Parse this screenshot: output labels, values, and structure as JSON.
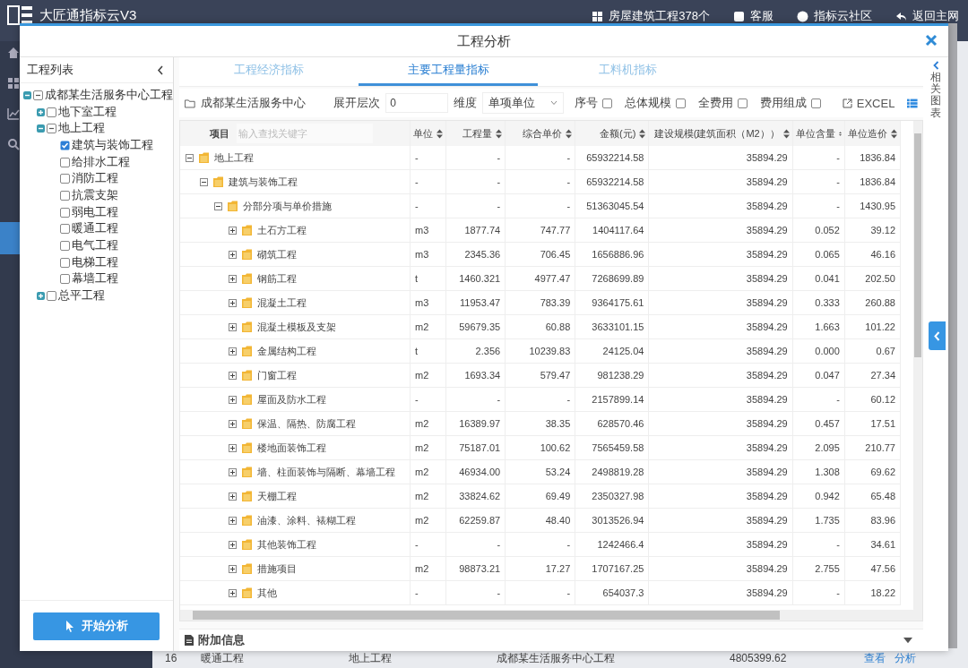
{
  "background": {
    "app_title": "大匠通指标云V3",
    "header_links": [
      {
        "label": "房屋建筑工程378个"
      },
      {
        "label": "客服"
      },
      {
        "label": "指标云社区"
      },
      {
        "label": "返回主网"
      }
    ],
    "row": {
      "number": "16",
      "name": "暖通工程",
      "parent": "地上工程",
      "project": "成都某生活服务中心工程",
      "amount": "4805399.62",
      "actions": [
        "查看",
        "分析"
      ]
    }
  },
  "dialog": {
    "title": "工程分析"
  },
  "project_tree": {
    "title": "工程列表",
    "items": [
      {
        "label": "成都某生活服务中心工程",
        "expanded": true,
        "checked": false,
        "partial": true,
        "children": [
          {
            "label": "地下室工程",
            "expanded": false,
            "checked": false,
            "partial": false
          },
          {
            "label": "地上工程",
            "expanded": true,
            "checked": false,
            "partial": true,
            "children": [
              {
                "label": "建筑与装饰工程",
                "checked": true,
                "partial": false
              },
              {
                "label": "给排水工程",
                "checked": false,
                "partial": false
              },
              {
                "label": "消防工程",
                "checked": false,
                "partial": false
              },
              {
                "label": "抗震支架",
                "checked": false,
                "partial": false
              },
              {
                "label": "弱电工程",
                "checked": false,
                "partial": false
              },
              {
                "label": "暖通工程",
                "checked": false,
                "partial": false
              },
              {
                "label": "电气工程",
                "checked": false,
                "partial": false
              },
              {
                "label": "电梯工程",
                "checked": false,
                "partial": false
              },
              {
                "label": "幕墙工程",
                "checked": false,
                "partial": false
              }
            ]
          },
          {
            "label": "总平工程",
            "expanded": false,
            "checked": false,
            "partial": false
          }
        ]
      }
    ]
  },
  "start_button": "开始分析",
  "tabs": [
    {
      "label": "工程经济指标",
      "selected": false
    },
    {
      "label": "主要工程量指标",
      "selected": true
    },
    {
      "label": "工料机指标",
      "selected": false
    }
  ],
  "toolbar": {
    "project": "成都某生活服务中心",
    "level_label": "展开层次",
    "level_value": "0",
    "dimension_label": "维度",
    "dimension_value": "单项单位",
    "options": [
      {
        "label": "序号",
        "checked": false
      },
      {
        "label": "总体规模",
        "checked": false
      },
      {
        "label": "全费用",
        "checked": false
      },
      {
        "label": "费用组成",
        "checked": false
      }
    ],
    "export": "EXCEL"
  },
  "table": {
    "search_placeholder": "输入查找关键字",
    "columns": [
      {
        "label": "项目",
        "sortable": false
      },
      {
        "label": "单位",
        "sortable": true
      },
      {
        "label": "工程量",
        "sortable": true
      },
      {
        "label": "综合单价",
        "sortable": true
      },
      {
        "label": "金额(元)",
        "sortable": true
      },
      {
        "label": "建设规模(建筑面积（M2））",
        "sortable": true
      },
      {
        "label": "单位含量",
        "sortable": true
      },
      {
        "label": "单位造价",
        "sortable": true
      }
    ],
    "rows": [
      {
        "name": "地上工程",
        "unit": "-",
        "quantity": "-",
        "unit_price": "-",
        "amount": "65932214.58",
        "scale": "35894.29",
        "content": "-",
        "cost": "1836.84",
        "expanded": true,
        "children": [
          {
            "name": "建筑与装饰工程",
            "unit": "-",
            "quantity": "-",
            "unit_price": "-",
            "amount": "65932214.58",
            "scale": "35894.29",
            "content": "-",
            "cost": "1836.84",
            "expanded": true,
            "children": [
              {
                "name": "分部分项与单价措施",
                "unit": "-",
                "quantity": "-",
                "unit_price": "-",
                "amount": "51363045.54",
                "scale": "35894.29",
                "content": "-",
                "cost": "1430.95",
                "expanded": true,
                "children": [
                  {
                    "name": "土石方工程",
                    "unit": "m3",
                    "quantity": "1877.74",
                    "unit_price": "747.77",
                    "amount": "1404117.64",
                    "scale": "35894.29",
                    "content": "0.052",
                    "cost": "39.12",
                    "expanded": false
                  },
                  {
                    "name": "砌筑工程",
                    "unit": "m3",
                    "quantity": "2345.36",
                    "unit_price": "706.45",
                    "amount": "1656886.96",
                    "scale": "35894.29",
                    "content": "0.065",
                    "cost": "46.16",
                    "expanded": false
                  },
                  {
                    "name": "钢筋工程",
                    "unit": "t",
                    "quantity": "1460.321",
                    "unit_price": "4977.47",
                    "amount": "7268699.89",
                    "scale": "35894.29",
                    "content": "0.041",
                    "cost": "202.50",
                    "expanded": false
                  },
                  {
                    "name": "混凝土工程",
                    "unit": "m3",
                    "quantity": "11953.47",
                    "unit_price": "783.39",
                    "amount": "9364175.61",
                    "scale": "35894.29",
                    "content": "0.333",
                    "cost": "260.88",
                    "expanded": false
                  },
                  {
                    "name": "混凝土模板及支架",
                    "unit": "m2",
                    "quantity": "59679.35",
                    "unit_price": "60.88",
                    "amount": "3633101.15",
                    "scale": "35894.29",
                    "content": "1.663",
                    "cost": "101.22",
                    "expanded": false
                  },
                  {
                    "name": "金属结构工程",
                    "unit": "t",
                    "quantity": "2.356",
                    "unit_price": "10239.83",
                    "amount": "24125.04",
                    "scale": "35894.29",
                    "content": "0.000",
                    "cost": "0.67",
                    "expanded": false
                  },
                  {
                    "name": "门窗工程",
                    "unit": "m2",
                    "quantity": "1693.34",
                    "unit_price": "579.47",
                    "amount": "981238.29",
                    "scale": "35894.29",
                    "content": "0.047",
                    "cost": "27.34",
                    "expanded": false
                  },
                  {
                    "name": "屋面及防水工程",
                    "unit": "-",
                    "quantity": "-",
                    "unit_price": "-",
                    "amount": "2157899.14",
                    "scale": "35894.29",
                    "content": "-",
                    "cost": "60.12",
                    "expanded": false
                  },
                  {
                    "name": "保温、隔热、防腐工程",
                    "unit": "m2",
                    "quantity": "16389.97",
                    "unit_price": "38.35",
                    "amount": "628570.46",
                    "scale": "35894.29",
                    "content": "0.457",
                    "cost": "17.51",
                    "expanded": false
                  },
                  {
                    "name": "楼地面装饰工程",
                    "unit": "m2",
                    "quantity": "75187.01",
                    "unit_price": "100.62",
                    "amount": "7565459.58",
                    "scale": "35894.29",
                    "content": "2.095",
                    "cost": "210.77",
                    "expanded": false
                  },
                  {
                    "name": "墙、柱面装饰与隔断、幕墙工程",
                    "unit": "m2",
                    "quantity": "46934.00",
                    "unit_price": "53.24",
                    "amount": "2498819.28",
                    "scale": "35894.29",
                    "content": "1.308",
                    "cost": "69.62",
                    "expanded": false
                  },
                  {
                    "name": "天棚工程",
                    "unit": "m2",
                    "quantity": "33824.62",
                    "unit_price": "69.49",
                    "amount": "2350327.98",
                    "scale": "35894.29",
                    "content": "0.942",
                    "cost": "65.48",
                    "expanded": false
                  },
                  {
                    "name": "油漆、涂料、裱糊工程",
                    "unit": "m2",
                    "quantity": "62259.87",
                    "unit_price": "48.40",
                    "amount": "3013526.94",
                    "scale": "35894.29",
                    "content": "1.735",
                    "cost": "83.96",
                    "expanded": false
                  },
                  {
                    "name": "其他装饰工程",
                    "unit": "-",
                    "quantity": "-",
                    "unit_price": "-",
                    "amount": "1242466.4",
                    "scale": "35894.29",
                    "content": "-",
                    "cost": "34.61",
                    "expanded": false
                  },
                  {
                    "name": "措施项目",
                    "unit": "m2",
                    "quantity": "98873.21",
                    "unit_price": "17.27",
                    "amount": "1707167.25",
                    "scale": "35894.29",
                    "content": "2.755",
                    "cost": "47.56",
                    "expanded": false
                  },
                  {
                    "name": "其他",
                    "unit": "-",
                    "quantity": "-",
                    "unit_price": "-",
                    "amount": "654037.3",
                    "scale": "35894.29",
                    "content": "-",
                    "cost": "18.22",
                    "expanded": false
                  }
                ]
              }
            ]
          }
        ]
      }
    ]
  },
  "extra_info": {
    "title": "附加信息"
  },
  "side_panel": {
    "title": "相关图表"
  }
}
